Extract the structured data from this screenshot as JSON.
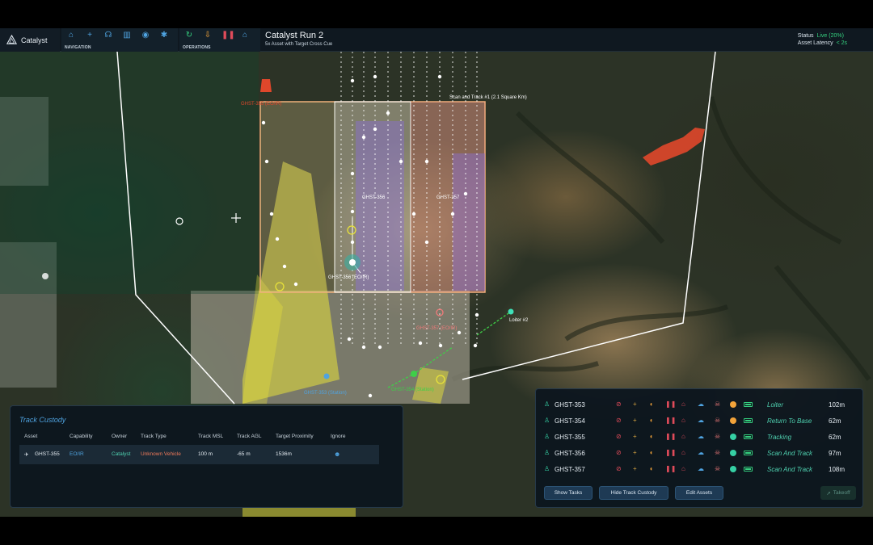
{
  "app": {
    "name": "Catalyst"
  },
  "nav_groups": {
    "navigation": {
      "label": "NAVIGATION",
      "icons": [
        "home-icon",
        "plus-icon",
        "headset-icon",
        "chart-icon",
        "eye-icon",
        "gear-icon"
      ]
    },
    "operations": {
      "label": "OPERATIONS",
      "icons": [
        "refresh-icon",
        "land-icon",
        "pause-icon",
        "home-icon"
      ]
    }
  },
  "run": {
    "title": "Catalyst Run 2",
    "subtitle": "5x Asset with Target Cross Cue"
  },
  "status": {
    "status_label": "Status",
    "status_value": "Live (20%)",
    "latency_label": "Asset Latency",
    "latency_value": "< 2s"
  },
  "map": {
    "labels": {
      "scan_area": "Scan and Track #1 (2.1 Square Km)",
      "ghst356": "GHST-356",
      "ghst357": "GHST-357",
      "ghst355_eoir": "GHST-355 (EO/IR)",
      "ghst357_eoir": "GHST-357 (EO/IR)",
      "ghst356_eoir": "GHST-356 (EO/IR)",
      "loiter": "Loiter #2",
      "ghst353_station": "GHST-353 (Station)",
      "ghst354_station": "GHST-354 (Station)"
    },
    "colors": {
      "fire": "#e0472b",
      "geofence": "#ffffff",
      "scan_box": "#f2b07a",
      "purple_lane": "#8a6fd6",
      "yellow_cone": "#e8e23a",
      "track_path": "#3fcf48"
    }
  },
  "track_custody": {
    "title": "Track Custody",
    "columns": [
      "Asset",
      "Capability",
      "Owner",
      "Track Type",
      "Track MSL",
      "Track AGL",
      "Target Proximity",
      "Ignore"
    ],
    "rows": [
      {
        "asset": "GHST-355",
        "capability": "EO/IR",
        "owner": "Catalyst",
        "track_type": "Unknown Vehicle",
        "track_msl": "100 m",
        "track_agl": "-65 m",
        "target_proximity": "1536m"
      }
    ]
  },
  "assets": {
    "rows": [
      {
        "name": "GHST-353",
        "task": "Loiter",
        "altitude": "102m",
        "status_color": "#f2a33a"
      },
      {
        "name": "GHST-354",
        "task": "Return To Base",
        "altitude": "62m",
        "status_color": "#f2a33a"
      },
      {
        "name": "GHST-355",
        "task": "Tracking",
        "altitude": "62m",
        "status_color": "#35d0a4"
      },
      {
        "name": "GHST-356",
        "task": "Scan And Track",
        "altitude": "97m",
        "status_color": "#35d0a4"
      },
      {
        "name": "GHST-357",
        "task": "Scan And Track",
        "altitude": "108m",
        "status_color": "#35d0a4"
      }
    ],
    "buttons": {
      "show_tasks": "Show Tasks",
      "hide_track_custody": "Hide Track Custody",
      "edit_assets": "Edit Assets",
      "takeoff": "Takeoff"
    }
  }
}
